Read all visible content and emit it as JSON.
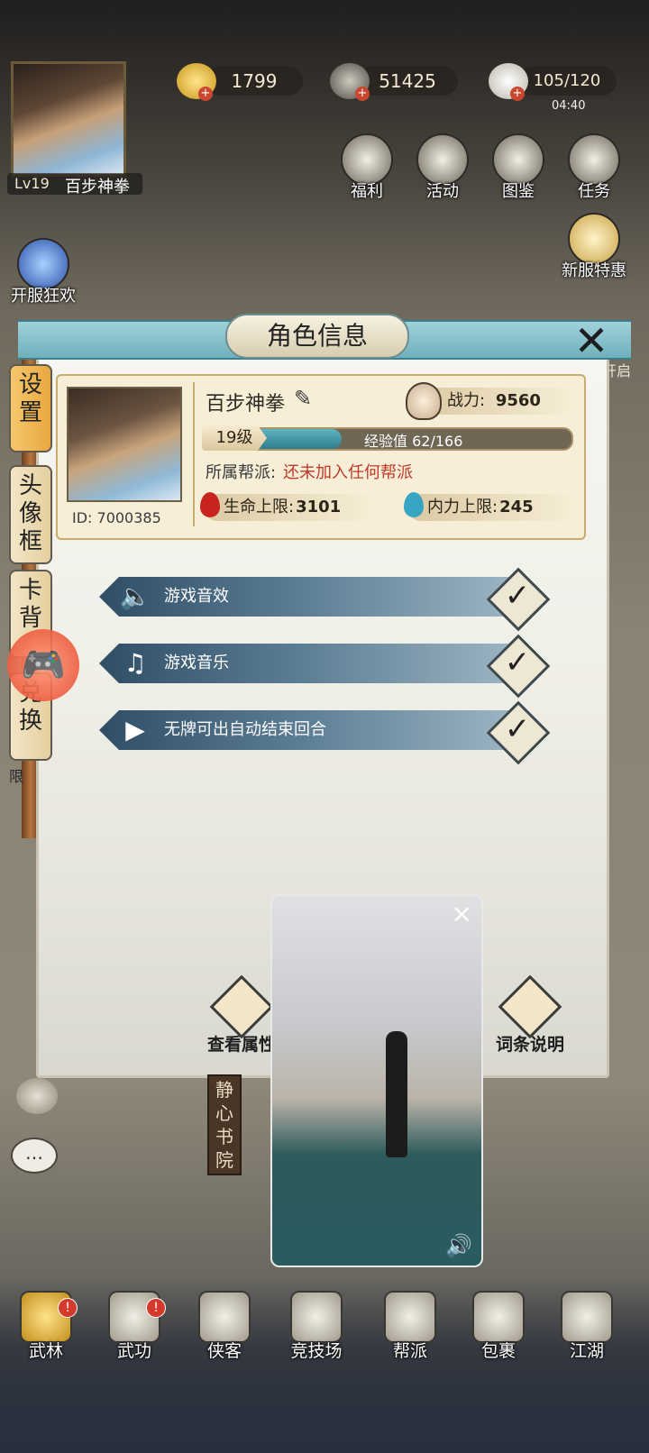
{
  "player": {
    "level": "Lv19",
    "name": "百步神拳"
  },
  "resources": [
    {
      "value": "1799"
    },
    {
      "value": "51425"
    },
    {
      "value": "105/120",
      "timer": "04:40"
    }
  ],
  "top_menu": [
    "福利",
    "活动",
    "图鉴",
    "任务"
  ],
  "events": {
    "new_server_deal": "新服特惠",
    "open_carnival": "开服狂欢"
  },
  "dialog": {
    "title": "角色信息",
    "tabs": [
      {
        "label": "设置"
      },
      {
        "label": "头像框"
      },
      {
        "label": "卡背"
      },
      {
        "label": "兑换"
      }
    ],
    "profile": {
      "name": "百步神拳",
      "id": "ID: 7000385",
      "power_label": "战力:",
      "power_value": "9560",
      "level": "19级",
      "exp_text": "经验值 62/166",
      "exp_fraction": 0.373,
      "faction_label": "所属帮派:",
      "faction_value": "还未加入任何帮派",
      "hp_label": "生命上限:",
      "hp_value": "3101",
      "mp_label": "内力上限:",
      "mp_value": "245"
    },
    "settings": [
      {
        "label": "游戏音效",
        "icon": "speaker-icon",
        "checked": true
      },
      {
        "label": "游戏音乐",
        "icon": "music-note-icon",
        "checked": true
      },
      {
        "label": "无牌可出自动结束回合",
        "icon": "play-icon",
        "checked": true
      }
    ],
    "footer": {
      "view_attributes": "查看属性",
      "term_explanation": "词条说明"
    }
  },
  "map_labels": {
    "building": "静心书院",
    "left_edge": "限",
    "right_edge": "开启"
  },
  "bottom_nav": [
    {
      "label": "武林",
      "badge": "!"
    },
    {
      "label": "武功",
      "badge": "!"
    },
    {
      "label": "侠客"
    },
    {
      "label": "竞技场"
    },
    {
      "label": "帮派"
    },
    {
      "label": "包裹"
    },
    {
      "label": "江湖"
    }
  ],
  "video_overlay": {
    "close": "×"
  },
  "colors": {
    "accent_teal": "#6fb0bc",
    "gold": "#c9ad6d",
    "exp_bar": "#2e7d8c"
  }
}
